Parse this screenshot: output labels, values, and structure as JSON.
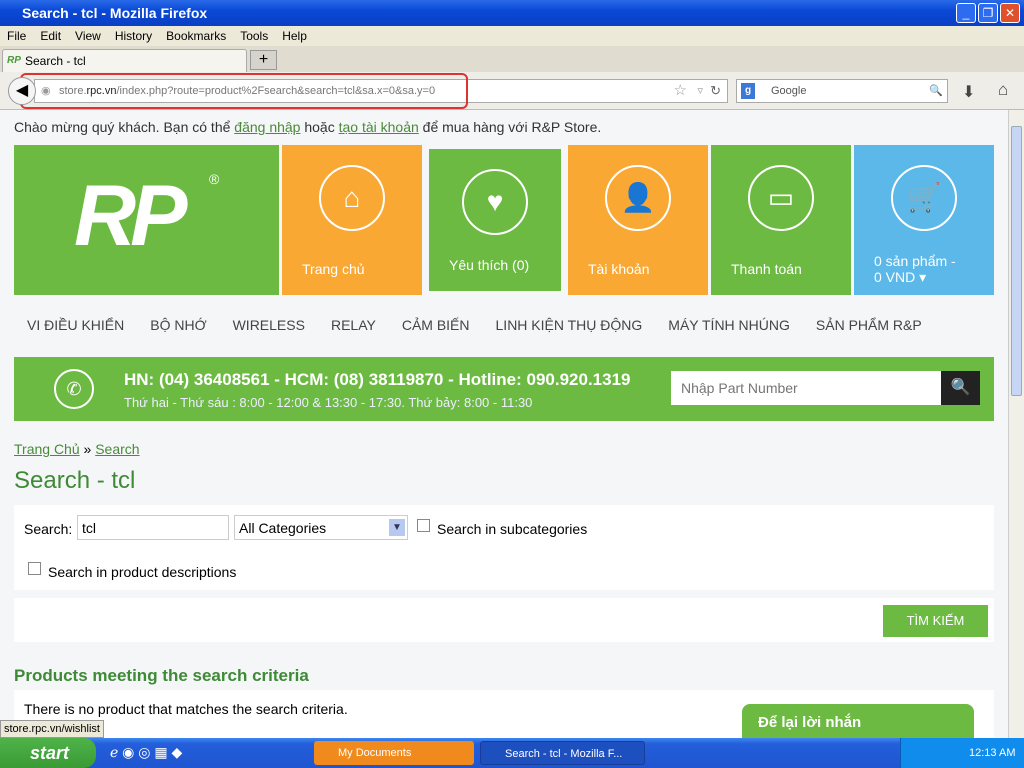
{
  "window": {
    "title": "Search - tcl - Mozilla Firefox"
  },
  "menu": [
    "File",
    "Edit",
    "View",
    "History",
    "Bookmarks",
    "Tools",
    "Help"
  ],
  "tab": {
    "label": "Search - tcl",
    "new_tab": "+"
  },
  "url": {
    "host_prefix": "store.",
    "host": "rpc.vn",
    "path": "/index.php?route=product%2Fsearch&search=tcl&sa.x=0&sa.y=0"
  },
  "search_engine": {
    "placeholder": "Google"
  },
  "welcome": {
    "prefix": "Chào mừng quý khách. Bạn có thể ",
    "login": "đăng nhập",
    "mid": " hoặc ",
    "register": "tạo tài khoản",
    "suffix": " để mua hàng với R&P Store."
  },
  "logo": {
    "text": "RP",
    "reg": "®"
  },
  "tiles": [
    {
      "label": "Trang chủ",
      "icon": "home-icon"
    },
    {
      "label": "Yêu thích (0)",
      "icon": "heart-icon"
    },
    {
      "label": "Tài khoản",
      "icon": "user-icon"
    },
    {
      "label": "Thanh toán",
      "icon": "credit-card-icon"
    },
    {
      "label": "0 sản phẩm -",
      "label2": "0 VND",
      "icon": "cart-icon"
    }
  ],
  "nav": [
    "VI ĐIỀU KHIỂN",
    "BỘ NHỚ",
    "WIRELESS",
    "RELAY",
    "CẢM BIẾN",
    "LINH KIỆN THỤ ĐỘNG",
    "MÁY TÍNH NHÚNG",
    "SẢN PHẨM R&P"
  ],
  "contact": {
    "line1": "HN: (04) 36408561 - HCM: (08) 38119870 - Hotline: 090.920.1319",
    "line2": "Thứ hai - Thứ sáu : 8:00 - 12:00 & 13:30 - 17:30. Thứ bảy: 8:00 - 11:30",
    "part_placeholder": "Nhập Part Number"
  },
  "breadcrumb": {
    "home": "Trang Chủ",
    "sep": "»",
    "current": "Search"
  },
  "heading": "Search - tcl",
  "form": {
    "search_label": "Search:",
    "search_value": "tcl",
    "category": "All Categories",
    "subcat": "Search in subcategories",
    "desc": "Search in product descriptions",
    "button": "TÌM KIẾM"
  },
  "results": {
    "heading": "Products meeting the search criteria",
    "empty": "There is no product that matches the search criteria."
  },
  "status_text": "store.rpc.vn/wishlist",
  "chat": "Để lại lời nhắn",
  "taskbar": {
    "start": "start",
    "items": [
      "My Documents",
      "Search - tcl - Mozilla F..."
    ],
    "clock": "12:13 AM"
  },
  "colors": {
    "green": "#6cba42",
    "orange": "#f9a833",
    "blue": "#5bb8e8"
  }
}
